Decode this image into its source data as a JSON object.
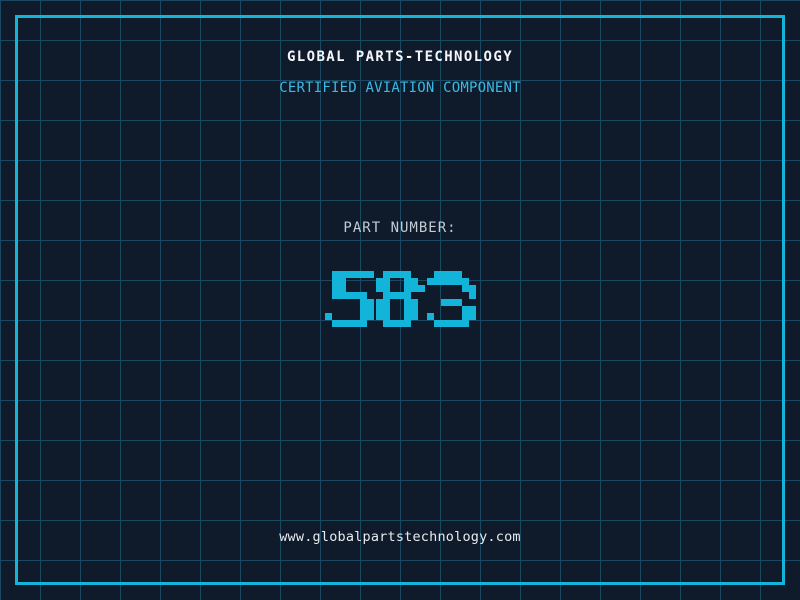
{
  "header": {
    "title": "GLOBAL PARTS-TECHNOLOGY",
    "subtitle": "CERTIFIED AVIATION COMPONENT"
  },
  "part": {
    "label": "PART NUMBER:",
    "number": "583"
  },
  "footer": {
    "url": "www.globalpartstechnology.com"
  },
  "colors": {
    "background": "#0f1a2b",
    "grid_line": "#1a4a63",
    "accent_cyan": "#13b4da",
    "subtitle_cyan": "#3cb9e4",
    "title_white": "#f4f7f9",
    "label_gray": "#c3ccd5",
    "url_white": "#e6ebef"
  }
}
